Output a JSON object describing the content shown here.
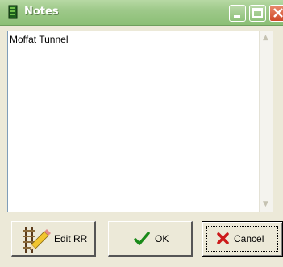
{
  "window": {
    "title": "Notes",
    "icon": "notes-app-icon",
    "controls": {
      "minimize_icon": "minimize-icon",
      "maximize_icon": "maximize-icon",
      "close_icon": "close-icon"
    }
  },
  "notes": {
    "text": "Moffat Tunnel"
  },
  "buttons": {
    "edit_rr": {
      "label": "Edit RR",
      "icon": "railroad-pencil-icon"
    },
    "ok": {
      "label": "OK",
      "icon": "checkmark-icon"
    },
    "cancel": {
      "label": "Cancel",
      "icon": "x-icon"
    }
  },
  "colors": {
    "titlebar": "#9ec98a",
    "ok_check": "#1a8a1a",
    "cancel_x": "#cc1a1a"
  }
}
